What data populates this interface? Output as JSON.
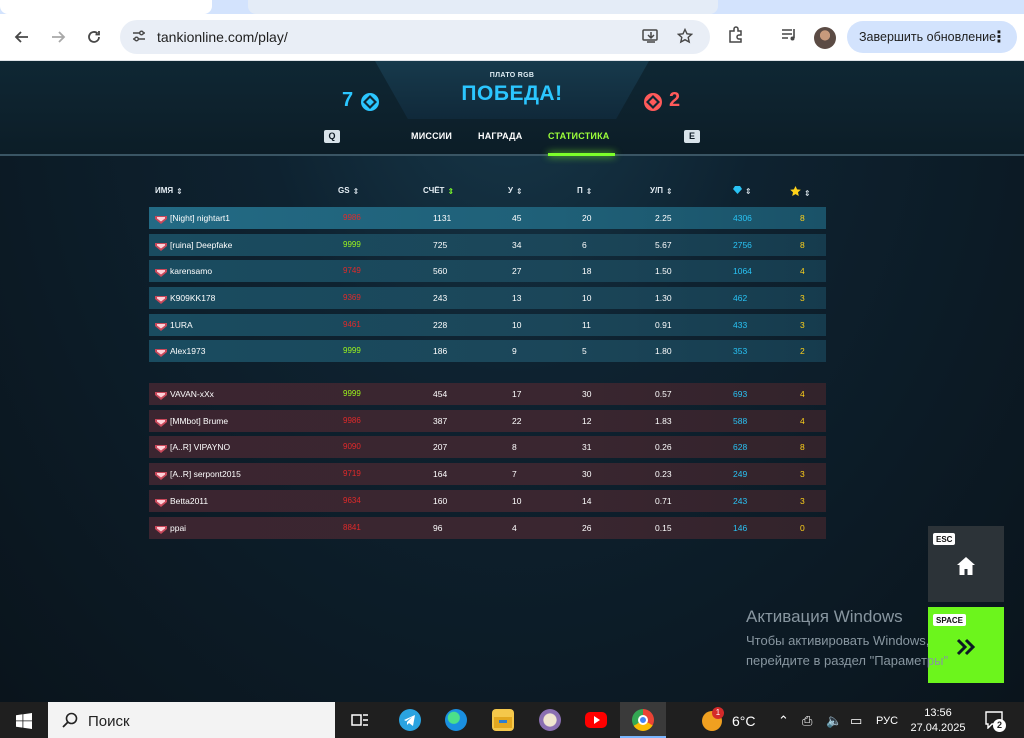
{
  "browser": {
    "url": "tankionline.com/play/",
    "update_button": "Завершить обновление"
  },
  "match": {
    "map_name": "ПЛАТО RGB",
    "result": "ПОБЕДА!",
    "score_blue": "7",
    "score_red": "2",
    "key_left": "Q",
    "key_right": "E",
    "tabs": [
      "МИССИИ",
      "НАГРАДА",
      "СТАТИСТИКА"
    ],
    "active_tab": "СТАТИСТИКА"
  },
  "table": {
    "headers": [
      "ИМЯ",
      "GS",
      "СЧЁТ",
      "У",
      "П",
      "У/П"
    ],
    "sorted_by": "СЧЁТ",
    "blue_team": [
      {
        "name": "[Night] nightart1",
        "gs": "9986",
        "gs_color": "#e02a2a",
        "score": "1131",
        "kills": "45",
        "deaths": "20",
        "kd": "2.25",
        "crystals": "4306",
        "stars": "8"
      },
      {
        "name": "[ruina] Deepfake",
        "gs": "9999",
        "gs_color": "#9cf51c",
        "score": "725",
        "kills": "34",
        "deaths": "6",
        "kd": "5.67",
        "crystals": "2756",
        "stars": "8"
      },
      {
        "name": "karensamo",
        "gs": "9749",
        "gs_color": "#e02a2a",
        "score": "560",
        "kills": "27",
        "deaths": "18",
        "kd": "1.50",
        "crystals": "1064",
        "stars": "4"
      },
      {
        "name": "K909KK178",
        "gs": "9369",
        "gs_color": "#e02a2a",
        "score": "243",
        "kills": "13",
        "deaths": "10",
        "kd": "1.30",
        "crystals": "462",
        "stars": "3"
      },
      {
        "name": "1URA",
        "gs": "9461",
        "gs_color": "#e02a2a",
        "score": "228",
        "kills": "10",
        "deaths": "11",
        "kd": "0.91",
        "crystals": "433",
        "stars": "3"
      },
      {
        "name": "Alex1973",
        "gs": "9999",
        "gs_color": "#9cf51c",
        "score": "186",
        "kills": "9",
        "deaths": "5",
        "kd": "1.80",
        "crystals": "353",
        "stars": "2"
      }
    ],
    "red_team": [
      {
        "name": "VAVAN-xXx",
        "gs": "9999",
        "gs_color": "#9cf51c",
        "score": "454",
        "kills": "17",
        "deaths": "30",
        "kd": "0.57",
        "crystals": "693",
        "stars": "4"
      },
      {
        "name": "[MMbot] Brume",
        "gs": "9986",
        "gs_color": "#e02a2a",
        "score": "387",
        "kills": "22",
        "deaths": "12",
        "kd": "1.83",
        "crystals": "588",
        "stars": "4"
      },
      {
        "name": "[A..R] VIPAYNO",
        "gs": "9090",
        "gs_color": "#e02a2a",
        "score": "207",
        "kills": "8",
        "deaths": "31",
        "kd": "0.26",
        "crystals": "628",
        "stars": "8"
      },
      {
        "name": "[A..R] serpont2015",
        "gs": "9719",
        "gs_color": "#e02a2a",
        "score": "164",
        "kills": "7",
        "deaths": "30",
        "kd": "0.23",
        "crystals": "249",
        "stars": "3"
      },
      {
        "name": "Betta2011",
        "gs": "9634",
        "gs_color": "#e02a2a",
        "score": "160",
        "kills": "10",
        "deaths": "14",
        "kd": "0.71",
        "crystals": "243",
        "stars": "3"
      },
      {
        "name": "ppai",
        "gs": "8841",
        "gs_color": "#e02a2a",
        "score": "96",
        "kills": "4",
        "deaths": "26",
        "kd": "0.15",
        "crystals": "146",
        "stars": "0"
      }
    ]
  },
  "side_buttons": {
    "esc_key": "ESC",
    "space_key": "SPACE"
  },
  "watermark": {
    "title": "Активация Windows",
    "line1": "Чтобы активировать Windows,",
    "line2": "перейдите в раздел \"Параметры\""
  },
  "taskbar": {
    "search_label": "Поиск",
    "temperature": "6°C",
    "language": "РУС",
    "time": "13:56",
    "date": "27.04.2025",
    "notifications": "2",
    "weather_badge": "1"
  }
}
